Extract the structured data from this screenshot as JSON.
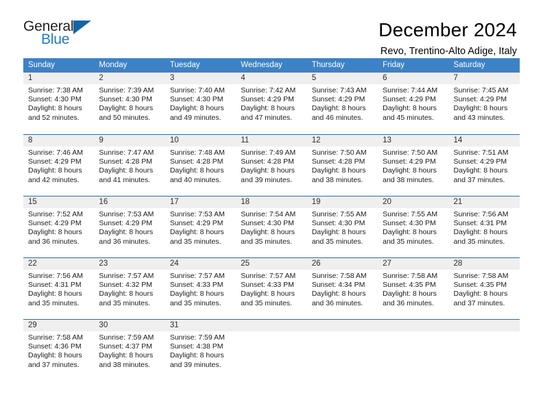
{
  "brand": {
    "name_part1": "General",
    "name_part2": "Blue",
    "accent_color": "#1464a5",
    "text_color": "#231f20"
  },
  "header": {
    "title": "December 2024",
    "subtitle": "Revo, Trentino-Alto Adige, Italy"
  },
  "calendar": {
    "header_bg": "#3d82c4",
    "header_text_color": "#ffffff",
    "daynum_band_color": "#efefef",
    "row_divider_color": "#2a6ba8",
    "weekdays": [
      "Sunday",
      "Monday",
      "Tuesday",
      "Wednesday",
      "Thursday",
      "Friday",
      "Saturday"
    ],
    "weeks": [
      [
        {
          "day": "1",
          "info": "Sunrise: 7:38 AM\nSunset: 4:30 PM\nDaylight: 8 hours\nand 52 minutes."
        },
        {
          "day": "2",
          "info": "Sunrise: 7:39 AM\nSunset: 4:30 PM\nDaylight: 8 hours\nand 50 minutes."
        },
        {
          "day": "3",
          "info": "Sunrise: 7:40 AM\nSunset: 4:30 PM\nDaylight: 8 hours\nand 49 minutes."
        },
        {
          "day": "4",
          "info": "Sunrise: 7:42 AM\nSunset: 4:29 PM\nDaylight: 8 hours\nand 47 minutes."
        },
        {
          "day": "5",
          "info": "Sunrise: 7:43 AM\nSunset: 4:29 PM\nDaylight: 8 hours\nand 46 minutes."
        },
        {
          "day": "6",
          "info": "Sunrise: 7:44 AM\nSunset: 4:29 PM\nDaylight: 8 hours\nand 45 minutes."
        },
        {
          "day": "7",
          "info": "Sunrise: 7:45 AM\nSunset: 4:29 PM\nDaylight: 8 hours\nand 43 minutes."
        }
      ],
      [
        {
          "day": "8",
          "info": "Sunrise: 7:46 AM\nSunset: 4:29 PM\nDaylight: 8 hours\nand 42 minutes."
        },
        {
          "day": "9",
          "info": "Sunrise: 7:47 AM\nSunset: 4:28 PM\nDaylight: 8 hours\nand 41 minutes."
        },
        {
          "day": "10",
          "info": "Sunrise: 7:48 AM\nSunset: 4:28 PM\nDaylight: 8 hours\nand 40 minutes."
        },
        {
          "day": "11",
          "info": "Sunrise: 7:49 AM\nSunset: 4:28 PM\nDaylight: 8 hours\nand 39 minutes."
        },
        {
          "day": "12",
          "info": "Sunrise: 7:50 AM\nSunset: 4:28 PM\nDaylight: 8 hours\nand 38 minutes."
        },
        {
          "day": "13",
          "info": "Sunrise: 7:50 AM\nSunset: 4:29 PM\nDaylight: 8 hours\nand 38 minutes."
        },
        {
          "day": "14",
          "info": "Sunrise: 7:51 AM\nSunset: 4:29 PM\nDaylight: 8 hours\nand 37 minutes."
        }
      ],
      [
        {
          "day": "15",
          "info": "Sunrise: 7:52 AM\nSunset: 4:29 PM\nDaylight: 8 hours\nand 36 minutes."
        },
        {
          "day": "16",
          "info": "Sunrise: 7:53 AM\nSunset: 4:29 PM\nDaylight: 8 hours\nand 36 minutes."
        },
        {
          "day": "17",
          "info": "Sunrise: 7:53 AM\nSunset: 4:29 PM\nDaylight: 8 hours\nand 35 minutes."
        },
        {
          "day": "18",
          "info": "Sunrise: 7:54 AM\nSunset: 4:30 PM\nDaylight: 8 hours\nand 35 minutes."
        },
        {
          "day": "19",
          "info": "Sunrise: 7:55 AM\nSunset: 4:30 PM\nDaylight: 8 hours\nand 35 minutes."
        },
        {
          "day": "20",
          "info": "Sunrise: 7:55 AM\nSunset: 4:30 PM\nDaylight: 8 hours\nand 35 minutes."
        },
        {
          "day": "21",
          "info": "Sunrise: 7:56 AM\nSunset: 4:31 PM\nDaylight: 8 hours\nand 35 minutes."
        }
      ],
      [
        {
          "day": "22",
          "info": "Sunrise: 7:56 AM\nSunset: 4:31 PM\nDaylight: 8 hours\nand 35 minutes."
        },
        {
          "day": "23",
          "info": "Sunrise: 7:57 AM\nSunset: 4:32 PM\nDaylight: 8 hours\nand 35 minutes."
        },
        {
          "day": "24",
          "info": "Sunrise: 7:57 AM\nSunset: 4:33 PM\nDaylight: 8 hours\nand 35 minutes."
        },
        {
          "day": "25",
          "info": "Sunrise: 7:57 AM\nSunset: 4:33 PM\nDaylight: 8 hours\nand 35 minutes."
        },
        {
          "day": "26",
          "info": "Sunrise: 7:58 AM\nSunset: 4:34 PM\nDaylight: 8 hours\nand 36 minutes."
        },
        {
          "day": "27",
          "info": "Sunrise: 7:58 AM\nSunset: 4:35 PM\nDaylight: 8 hours\nand 36 minutes."
        },
        {
          "day": "28",
          "info": "Sunrise: 7:58 AM\nSunset: 4:35 PM\nDaylight: 8 hours\nand 37 minutes."
        }
      ],
      [
        {
          "day": "29",
          "info": "Sunrise: 7:58 AM\nSunset: 4:36 PM\nDaylight: 8 hours\nand 37 minutes."
        },
        {
          "day": "30",
          "info": "Sunrise: 7:59 AM\nSunset: 4:37 PM\nDaylight: 8 hours\nand 38 minutes."
        },
        {
          "day": "31",
          "info": "Sunrise: 7:59 AM\nSunset: 4:38 PM\nDaylight: 8 hours\nand 39 minutes."
        },
        {
          "day": "",
          "info": ""
        },
        {
          "day": "",
          "info": ""
        },
        {
          "day": "",
          "info": ""
        },
        {
          "day": "",
          "info": ""
        }
      ]
    ]
  }
}
